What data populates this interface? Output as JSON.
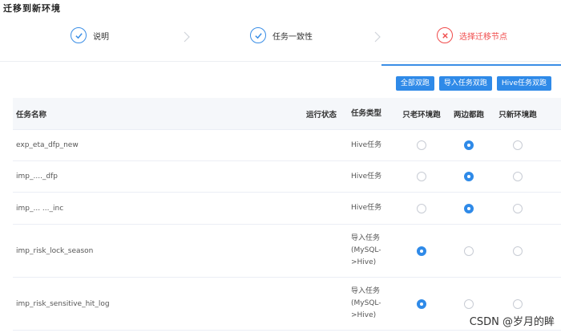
{
  "dialog": {
    "title": "迁移到新环境"
  },
  "steps": [
    {
      "label": "说明",
      "state": "done"
    },
    {
      "label": "任务一致性",
      "state": "done"
    },
    {
      "label": "选择迁移节点",
      "state": "error"
    }
  ],
  "toolbar": {
    "all_double_label": "全部双跑",
    "import_double_label": "导入任务双跑",
    "hive_double_label": "Hive任务双跑"
  },
  "table": {
    "headers": {
      "name": "任务名称",
      "status": "运行状态",
      "type": "任务类型",
      "old_only": "只老环境跑",
      "both": "两边都跑",
      "new_only": "只新环境跑"
    },
    "rows": [
      {
        "name": "exp_eta_dfp_new",
        "status": "",
        "type": "Hive任务",
        "selected": "both"
      },
      {
        "name": "imp_...._dfp",
        "status": "",
        "type": "Hive任务",
        "selected": "both"
      },
      {
        "name": "imp_... ..._inc",
        "status": "",
        "type": "Hive任务",
        "selected": "both"
      },
      {
        "name": "imp_risk_lock_season",
        "status": "",
        "type": "导入任务 (MySQL->Hive)",
        "selected": "old_only"
      },
      {
        "name": "imp_risk_sensitive_hit_log",
        "status": "",
        "type": "导入任务 (MySQL->Hive)",
        "selected": "old_only"
      }
    ]
  },
  "watermark": "CSDN @岁月的眸",
  "colors": {
    "primary": "#2f8ae8",
    "error": "#f04b4b"
  }
}
